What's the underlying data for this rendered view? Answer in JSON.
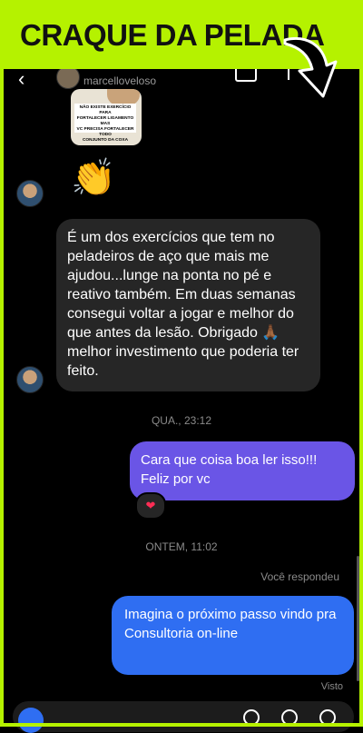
{
  "banner": {
    "title": "CRAQUE DA PELADA"
  },
  "header": {
    "username": "marcelloveloso",
    "back_glyph": "‹"
  },
  "shared_image": {
    "lines": [
      "NÃO EXISTE EXERCÍCIO PARA",
      "FORTALECER LIGAMENTO MAS",
      "VC PRECISA FORTALECER TODO",
      "CONJUNTO DA COXA"
    ]
  },
  "emoji_message": "👏",
  "messages": {
    "incoming_text": "É um dos exercícios que tem no peladeiros de aço que mais me ajudou...lunge na ponta no pé e reativo também. Em duas semanas consegui voltar a jogar e melhor do que antes da lesão. Obrigado 🙏🏾 melhor investimento que poderia ter feito.",
    "time1": "QUA., 23:12",
    "outgoing1": "Cara que coisa boa ler isso!!! Feliz por vc",
    "reaction": "❤",
    "time2": "ONTEM, 11:02",
    "replied_label": "Você respondeu",
    "outgoing2": "Imagina o próximo passo vindo pra Consultoria on-line",
    "seen_label": "Visto"
  },
  "colors": {
    "banner": "#b5f200",
    "outgoing_purple": "#6a55e6",
    "outgoing_blue": "#2f6ef2",
    "incoming": "#262626"
  },
  "icons": [
    "back-icon",
    "video-call-icon",
    "flag-icon",
    "arrow-down-icon",
    "camera-icon",
    "heart-icon"
  ]
}
